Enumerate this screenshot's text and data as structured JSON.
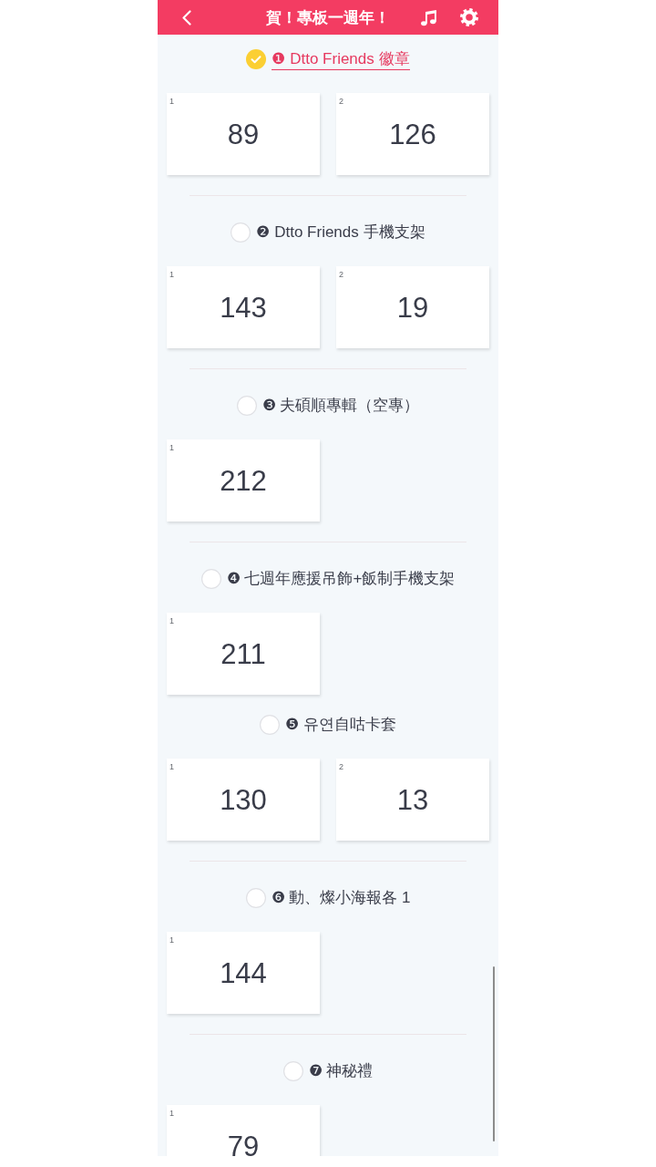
{
  "header": {
    "title": "賀！專板一週年！"
  },
  "sections": [
    {
      "title": "❶ Dtto Friends 徽章",
      "selected": true,
      "divider_before": false,
      "cards": [
        {
          "index": "1",
          "value": "89"
        },
        {
          "index": "2",
          "value": "126"
        }
      ]
    },
    {
      "title": "❷ Dtto Friends 手機支架",
      "selected": false,
      "divider_before": true,
      "cards": [
        {
          "index": "1",
          "value": "143"
        },
        {
          "index": "2",
          "value": "19"
        }
      ]
    },
    {
      "title": "❸ 夫碩順專輯（空專）",
      "selected": false,
      "divider_before": true,
      "cards": [
        {
          "index": "1",
          "value": "212"
        }
      ]
    },
    {
      "title": "❹ 七週年應援吊飾+飯制手機支架",
      "selected": false,
      "divider_before": true,
      "cards": [
        {
          "index": "1",
          "value": "211"
        }
      ]
    },
    {
      "title": "❺ 유연自咕卡套",
      "selected": false,
      "divider_before": false,
      "cards": [
        {
          "index": "1",
          "value": "130"
        },
        {
          "index": "2",
          "value": "13"
        }
      ]
    },
    {
      "title": "❻ 動、燦小海報各 1",
      "selected": false,
      "divider_before": true,
      "cards": [
        {
          "index": "1",
          "value": "144"
        }
      ]
    },
    {
      "title": "❼ 神秘禮",
      "selected": false,
      "divider_before": true,
      "cards": [
        {
          "index": "1",
          "value": "79"
        }
      ]
    }
  ]
}
